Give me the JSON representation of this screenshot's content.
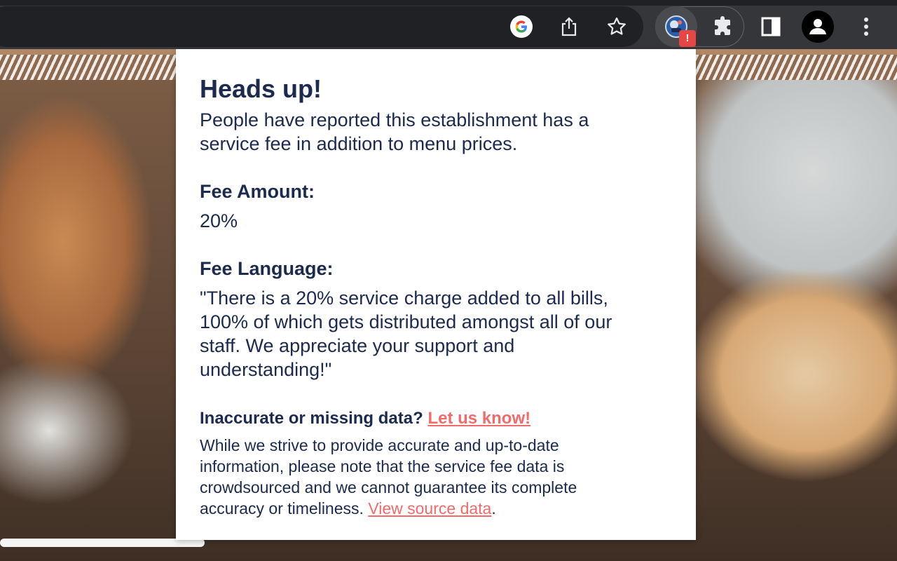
{
  "colors": {
    "heading": "#1b2a4e",
    "link": "#f26b6b",
    "toolbar": "#35363a",
    "badge": "#e64646"
  },
  "toolbar": {
    "icons": [
      "google-icon",
      "share-icon",
      "bookmark-star-icon",
      "extension-icon",
      "puzzle-icon",
      "side-panel-icon",
      "profile-icon",
      "more-icon"
    ],
    "badge_text": "!"
  },
  "popup": {
    "title": "Heads up!",
    "lead": "People have reported this establishment has a service fee in addition to menu prices.",
    "fee_amount_label": "Fee Amount:",
    "fee_amount": "20%",
    "fee_language_label": "Fee Language:",
    "fee_language": "\"There is a 20% service charge added to all bills, 100% of which gets distributed amongst all of our staff. We appreciate your support and understanding!\"",
    "report_text": "Inaccurate or missing data?",
    "report_link": "Let us know!",
    "disclaimer": "While we strive to provide accurate and up-to-date information, please note that the service fee data is crowdsourced and we cannot guarantee its complete accuracy or timeliness.",
    "source_link": "View source data",
    "disclaimer_end": "."
  }
}
